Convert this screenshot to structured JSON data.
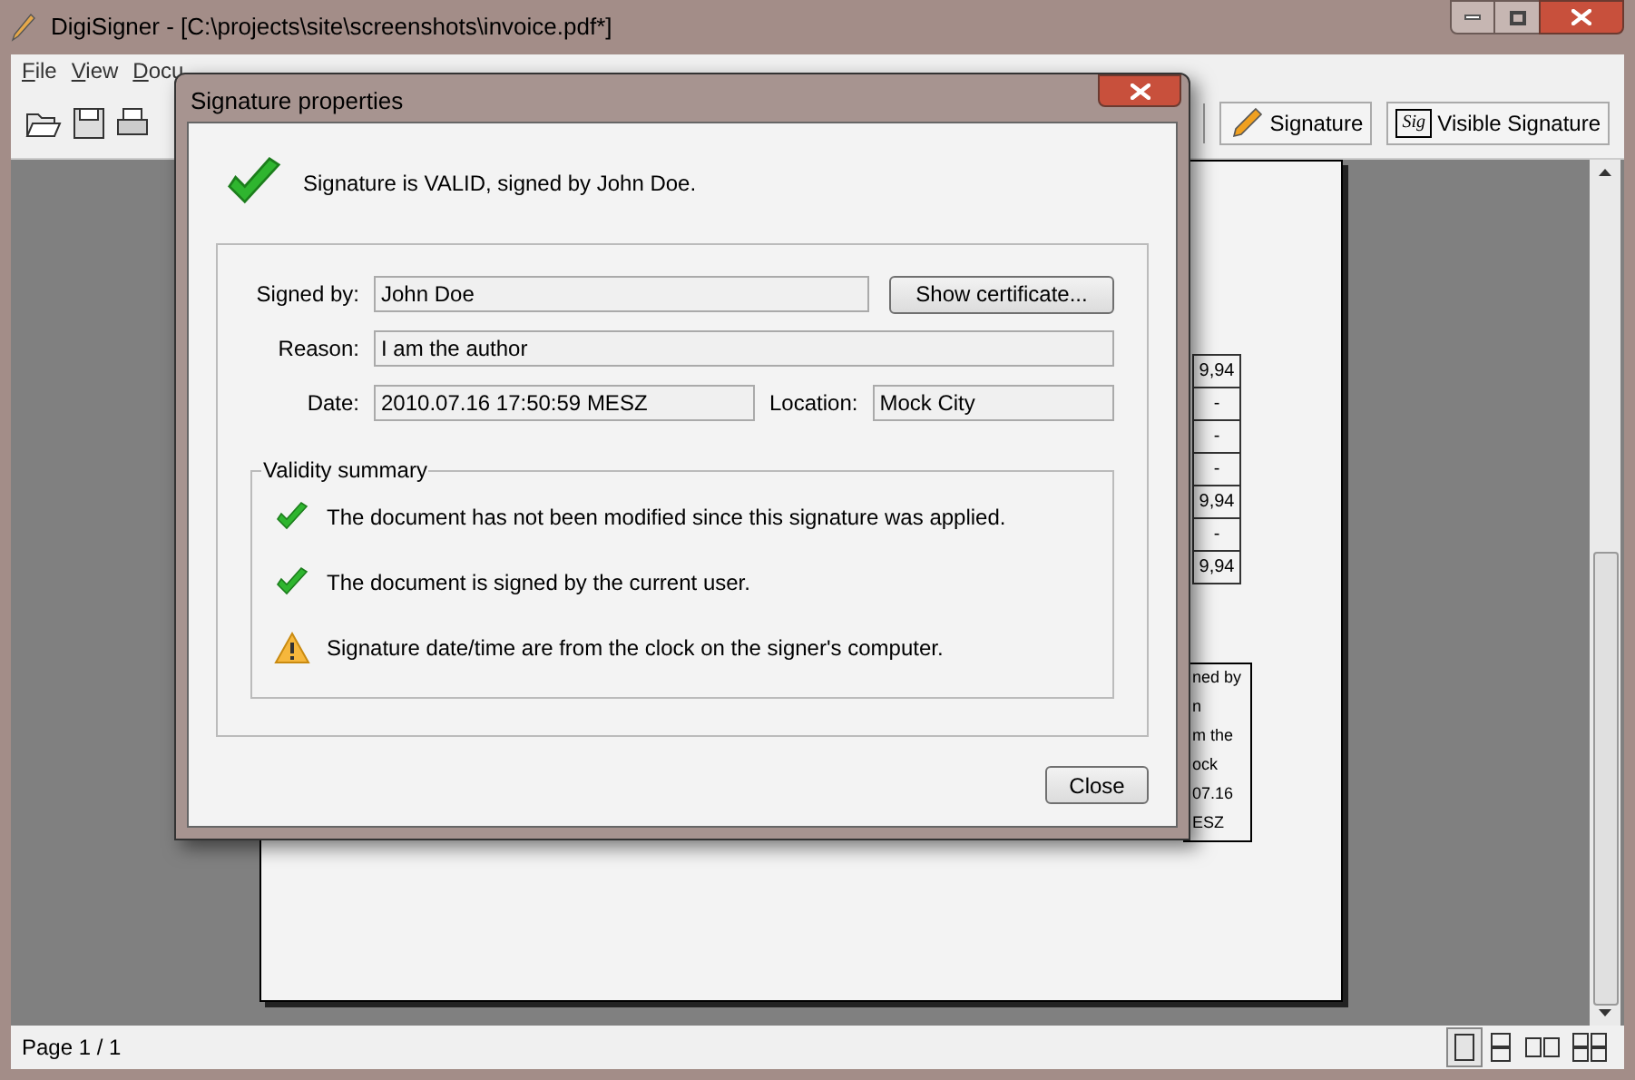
{
  "window": {
    "title": "DigiSigner - [C:\\projects\\site\\screenshots\\invoice.pdf*]"
  },
  "menu": [
    {
      "label": "File"
    },
    {
      "label": "View"
    },
    {
      "label": "Docu"
    }
  ],
  "toolbar": {
    "buttons": [
      {
        "kind": "pen",
        "label": "Signature"
      },
      {
        "kind": "sig",
        "label": "Visible Signature",
        "icon_text": "Sig"
      }
    ]
  },
  "document": {
    "table_cells": [
      "9,94",
      "-",
      "-",
      "-",
      "9,94",
      "-",
      "9,94"
    ],
    "note_lines": [
      "ned by",
      "n",
      "m the",
      "ock",
      "07.16",
      "ESZ"
    ]
  },
  "dialog": {
    "title": "Signature properties",
    "status": {
      "kind": "ok",
      "text": "Signature is VALID, signed by John Doe."
    },
    "rows": [
      {
        "fields": [
          {
            "label": "Signed by:",
            "value": "John Doe"
          }
        ],
        "button": "Show certificate..."
      },
      {
        "fields": [
          {
            "label": "Reason:",
            "value": "I am the author"
          }
        ]
      },
      {
        "fields": [
          {
            "label": "Date:",
            "value": "2010.07.16 17:50:59 MESZ"
          },
          {
            "label": "Location:",
            "value": "Mock City"
          }
        ]
      }
    ],
    "validity": {
      "title": "Validity summary",
      "items": [
        {
          "kind": "ok",
          "text": "The document has not been modified since this signature was applied."
        },
        {
          "kind": "ok",
          "text": "The document is signed by the current user."
        },
        {
          "kind": "warning",
          "text": "Signature date/time are from the clock on the signer's computer."
        }
      ]
    },
    "close": "Close"
  },
  "status_bar": {
    "page": "Page 1 / 1",
    "view_modes": [
      {
        "kind": "single",
        "selected": true
      },
      {
        "kind": "continuous",
        "selected": false
      },
      {
        "kind": "facing",
        "selected": false
      },
      {
        "kind": "facing-continuous",
        "selected": false
      }
    ]
  }
}
